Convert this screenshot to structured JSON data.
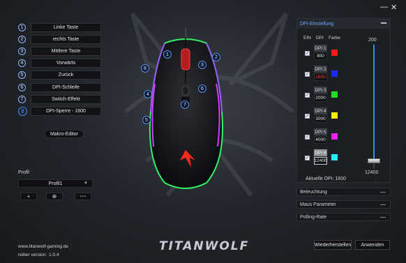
{
  "window": {
    "minimize_glyph": "—",
    "close_glyph": "✕"
  },
  "buttons": [
    {
      "num": "1",
      "label": "Linke Taste"
    },
    {
      "num": "2",
      "label": "rechts Taste"
    },
    {
      "num": "3",
      "label": "Mittlere Taste"
    },
    {
      "num": "4",
      "label": "Vorwärts"
    },
    {
      "num": "5",
      "label": "Zurück"
    },
    {
      "num": "6",
      "label": "DPI-Schleife"
    },
    {
      "num": "7",
      "label": "Switch-Effekt"
    },
    {
      "num": "8",
      "label": "DPI-Sperre - 1600"
    }
  ],
  "makro_label": "Makro-Editor",
  "profile": {
    "label": "Profil",
    "selected": "Profil1",
    "add": "+",
    "settings": "⊕",
    "more": "• • •"
  },
  "footer": {
    "website": "www.titanwolf-gaming.de",
    "version_label": "reiber version:",
    "version": "1.0.4"
  },
  "logo_text": "TITANWOLF",
  "dpi": {
    "header": "DPI-Einstellung",
    "col_enable": "EIN",
    "col_dpi": "DPI",
    "col_color": "Farbe",
    "levels": [
      {
        "name": "DPI 1",
        "value": "800",
        "color": "#ff1a1a",
        "selected": false
      },
      {
        "name": "DPI 2",
        "value": "1600",
        "color": "#1a2bff",
        "selected": false,
        "value_color": "#ff3030"
      },
      {
        "name": "DPI 3",
        "value": "2000",
        "color": "#22dd22",
        "selected": false
      },
      {
        "name": "DPI 4",
        "value": "3000",
        "color": "#ffee00",
        "selected": false
      },
      {
        "name": "DPI 5",
        "value": "4000",
        "color": "#ee22ee",
        "selected": false
      },
      {
        "name": "DPI 6",
        "value": "12400",
        "color": "#22eeff",
        "selected": true
      }
    ],
    "current_label": "Aktuelle DPI: 1600",
    "slider_max": "200",
    "slider_value": "12400",
    "slider_level": 0.06
  },
  "sections": [
    "Beleuchtung",
    "Maus Parameter",
    "Polling-Rate"
  ],
  "actions": {
    "restore": "Wiederherstellen",
    "apply": "Anwenden"
  },
  "accent": "#4a8fff"
}
